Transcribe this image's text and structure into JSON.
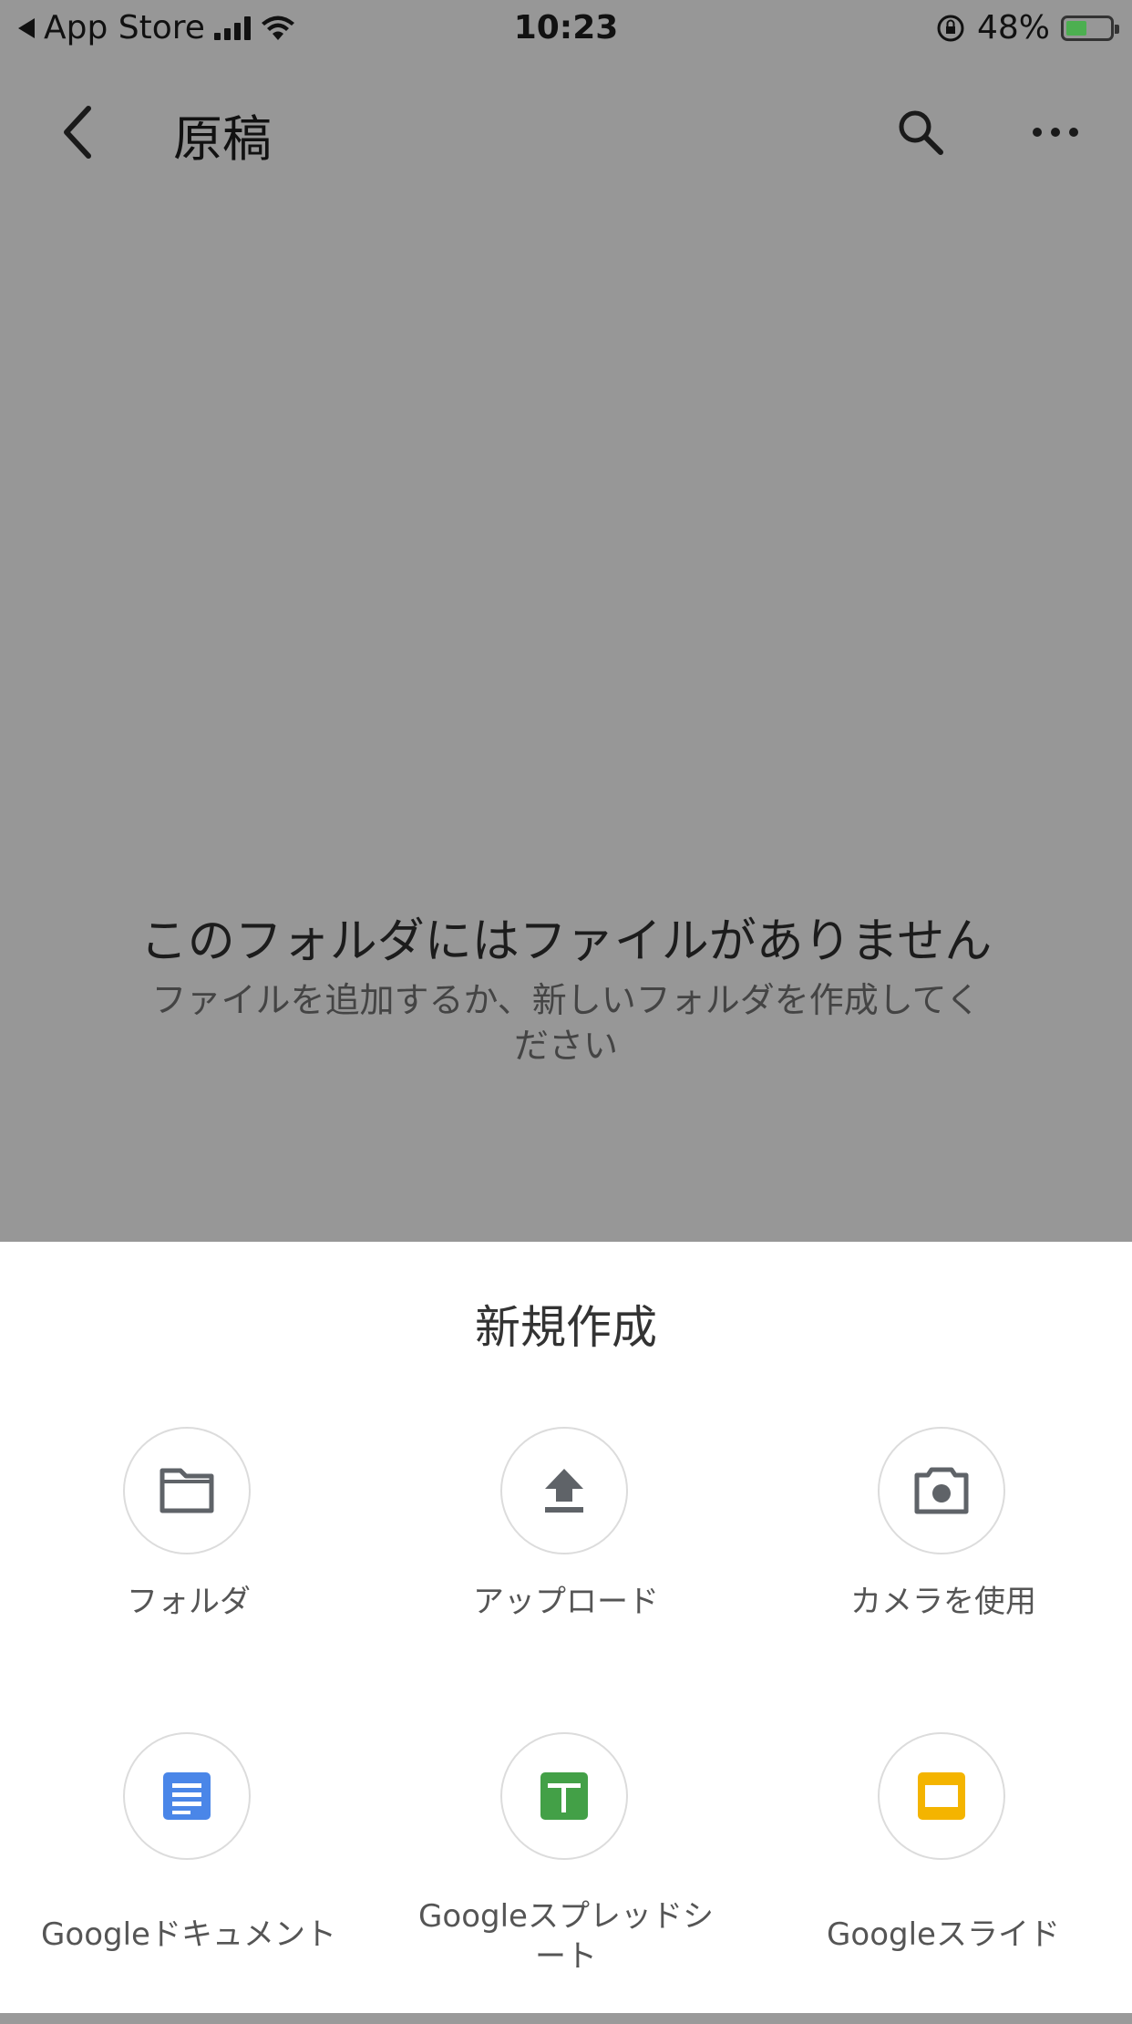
{
  "status_bar": {
    "back_app": "App Store",
    "time": "10:23",
    "battery_percent": "48%",
    "battery_level": 0.48,
    "battery_color": "#4caf50"
  },
  "toolbar": {
    "title": "原稿",
    "back_icon": "chevron-left-icon",
    "search_icon": "search-icon",
    "more_icon": "more-horizontal-icon"
  },
  "empty_state": {
    "title": "このフォルダにはファイルがありません",
    "subtitle": "ファイルを追加するか、新しいフォルダを作成してください"
  },
  "sheet": {
    "title": "新規作成",
    "items": [
      {
        "label": "フォルダ",
        "icon": "folder-icon"
      },
      {
        "label": "アップロード",
        "icon": "upload-icon"
      },
      {
        "label": "カメラを使用",
        "icon": "camera-icon"
      },
      {
        "label": "Googleドキュメント",
        "icon": "google-docs-icon",
        "color": "#4a86e8"
      },
      {
        "label": "Googleスプレッドシート",
        "icon": "google-sheets-icon",
        "color": "#43a047"
      },
      {
        "label": "Googleスライド",
        "icon": "google-slides-icon",
        "color": "#f4b400"
      }
    ]
  },
  "colors": {
    "scrim": "#979797",
    "sheet_bg": "#ffffff",
    "icon_gray": "#5f6368"
  }
}
